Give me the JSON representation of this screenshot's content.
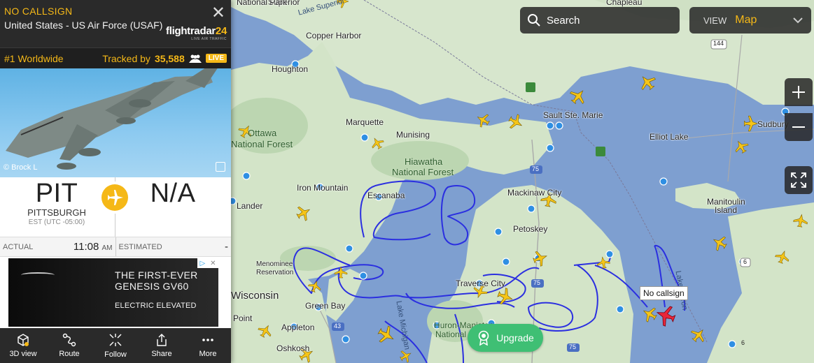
{
  "panel": {
    "callsign": "NO CALLSIGN",
    "operator": "United States - US Air Force (USAF)",
    "logo_brand": "flightradar",
    "logo_num": "24",
    "logo_sub": "LIVE AIR TRAFFIC",
    "rank": "#1 Worldwide",
    "tracked_prefix": "Tracked by",
    "tracked_count": "35,588",
    "live_label": "LIVE",
    "photo_credit": "© Brock L",
    "origin": {
      "code": "PIT",
      "city": "PITTSBURGH",
      "tz": "EST (UTC -05:00)"
    },
    "destination": {
      "code": "N/A"
    },
    "actual_label": "ACTUAL",
    "actual_time": "11:08",
    "actual_ampm": "AM",
    "estimated_label": "ESTIMATED",
    "estimated_value": "-",
    "ad": {
      "headline_1": "THE FIRST-EVER",
      "headline_2": "GENESIS GV60",
      "sub": "ELECTRIC ELEVATED"
    },
    "toolbar": [
      "3D view",
      "Route",
      "Follow",
      "Share",
      "More"
    ]
  },
  "search_label": "Search",
  "view_label": "VIEW",
  "view_value": "Map",
  "upgrade_label": "Upgrade",
  "tooltip_label": "No callsign",
  "map_labels": [
    "Superior",
    "National Park",
    "Lake Superior",
    "Chapleau",
    "Copper Harbor",
    "Houghton",
    "Marquette",
    "Munising",
    "Ottawa",
    "National Forest",
    "Hiawatha",
    "National Forest",
    "Iron Mountain",
    "Escanaba",
    "Sault Ste. Marie",
    "Elliot Lake",
    "Sudbury",
    "Mackinaw City",
    "Petoskey",
    "Manitoulin",
    "Island",
    "Lander",
    "Menominee",
    "Reservation",
    "Traverse City",
    "Lake Michigan",
    "Lake Huron",
    "Huron-Manistee",
    "National",
    "Green Bay",
    "Appleton",
    "Oshkosh",
    "Point",
    "Wisconsin",
    "144",
    "75",
    "75",
    "75",
    "43",
    "6",
    "6"
  ],
  "colors": {
    "accent": "#f5b817",
    "track": "#2b2fe0",
    "water": "#7e9fd0",
    "land": "#d9e7d0",
    "upgrade": "#3fbf74"
  }
}
